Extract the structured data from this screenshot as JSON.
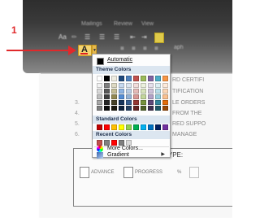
{
  "annotation": {
    "step": "1"
  },
  "ribbon": {
    "tabs": [
      "Mailings",
      "Review",
      "View"
    ],
    "font_row_glyphs": [
      "Aa",
      "☰",
      "☰",
      "☰",
      "¶"
    ],
    "group_label": "aph"
  },
  "font_color_button": {
    "glyph": "A"
  },
  "dropdown": {
    "automatic": "Automatic",
    "theme_colors_label": "Theme Colors",
    "standard_colors_label": "Standard Colors",
    "recent_colors_label": "Recent Colors",
    "more_colors": "More Colors...",
    "gradient": "Gradient",
    "theme_colors": [
      [
        "#ffffff",
        "#f2f2f2",
        "#d9d9d9",
        "#bfbfbf",
        "#a6a6a6",
        "#7f7f7f"
      ],
      [
        "#000000",
        "#7f7f7f",
        "#595959",
        "#3f3f3f",
        "#262626",
        "#0d0d0d"
      ],
      [
        "#eeece1",
        "#ddd9c3",
        "#c4bd97",
        "#938953",
        "#494429",
        "#1d1b10"
      ],
      [
        "#1f497d",
        "#c6d9f0",
        "#8db3e2",
        "#548dd4",
        "#17365d",
        "#0f243e"
      ],
      [
        "#4f81bd",
        "#dbe5f1",
        "#b8cce4",
        "#95b3d7",
        "#366092",
        "#244061"
      ],
      [
        "#c0504d",
        "#f2dcdb",
        "#e5b9b7",
        "#d99694",
        "#953734",
        "#632423"
      ],
      [
        "#9bbb59",
        "#ebf1dd",
        "#d7e3bc",
        "#c3d69b",
        "#76923c",
        "#4f6128"
      ],
      [
        "#8064a2",
        "#e5e0ec",
        "#ccc1d9",
        "#b2a2c7",
        "#5f497a",
        "#3f3151"
      ],
      [
        "#4bacc6",
        "#dbeef3",
        "#b7dde8",
        "#92cddc",
        "#31859b",
        "#205867"
      ],
      [
        "#f79646",
        "#fdeada",
        "#fbd5b5",
        "#fac08f",
        "#e36c09",
        "#974806"
      ]
    ],
    "standard_colors": [
      "#c00000",
      "#ff0000",
      "#ffc000",
      "#ffff00",
      "#92d050",
      "#00b050",
      "#00b0f0",
      "#0070c0",
      "#002060",
      "#7030a0"
    ],
    "recent_colors": [
      "#c0504d",
      "#808080",
      "#ff0000",
      "#7f7f7f",
      "#d9d9d9"
    ]
  },
  "document": {
    "partial_lines": [
      "RD CERTIFI",
      "TIFICATION",
      "LE ORDERS",
      "FROM THE",
      "RED SUPPO",
      "MANAGE"
    ],
    "list_numbers": [
      "3.",
      "4.",
      "5.",
      "6."
    ],
    "type_label": "TYPE:",
    "checkbox_labels": [
      "ADVANCE",
      "PROGRESS",
      "%"
    ]
  }
}
